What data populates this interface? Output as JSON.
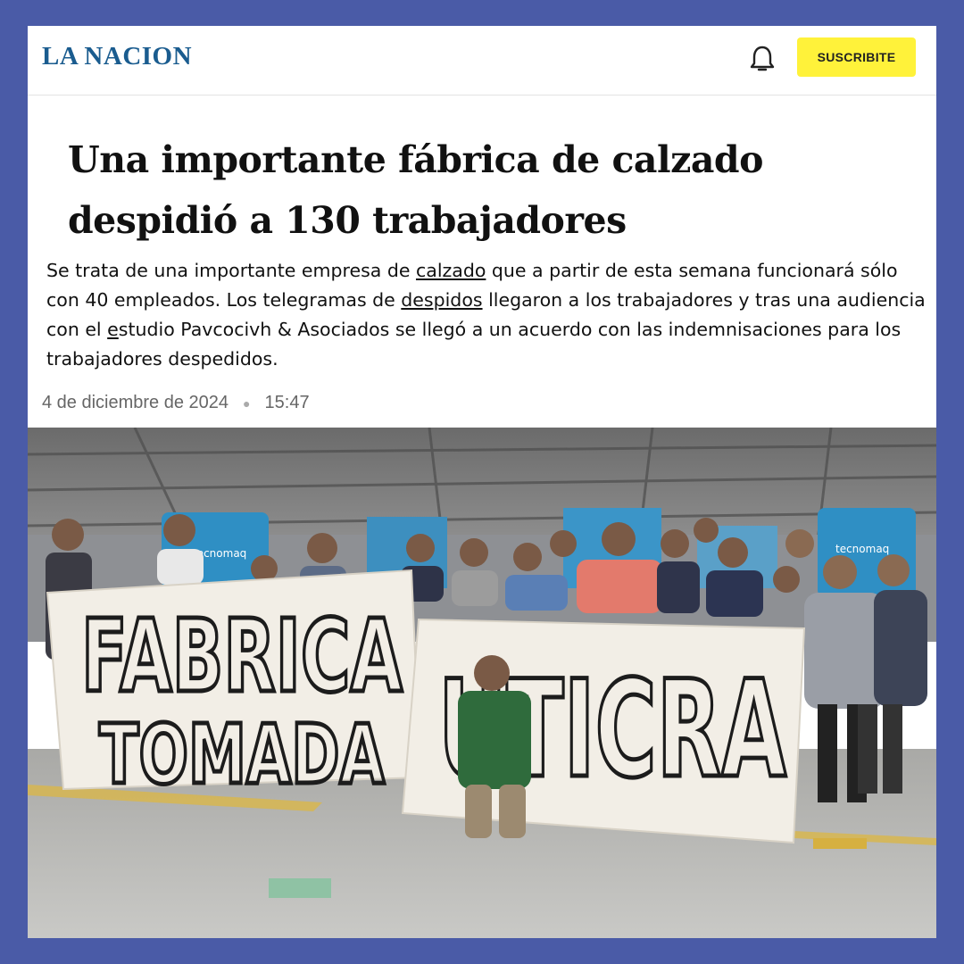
{
  "header": {
    "logo": "LA NACION",
    "bell_icon": "bell-icon",
    "subscribe_label": "SUSCRIBITE"
  },
  "article": {
    "title": "Una importante fábrica de calzado despidió a 130 trabajadores",
    "lead": {
      "p1": "Se trata de una importante empresa de ",
      "link1": "calzado",
      "p2": " que a partir de esta semana funcionará sólo con 40 empleados. Los telegramas de ",
      "link2": "despidos",
      "p3": "  llegaron a los trabajadores y tras una audiencia con el ",
      "link3": "e",
      "p4": "studio Pavcocivh & Asociados  se llegó a un acuerdo con las indemnisaciones para los trabajadores despedidos."
    },
    "date": "4 de diciembre de 2024",
    "time": "15:47"
  },
  "photo": {
    "banner_left_line1": "FABRICA",
    "banner_left_line2": "TOMADA",
    "banner_right": "UTICRA",
    "machine_brand": "tecnomaq"
  },
  "colors": {
    "background": "#4a5ba7",
    "logo": "#1a5c8f",
    "subscribe": "#fff23a"
  }
}
